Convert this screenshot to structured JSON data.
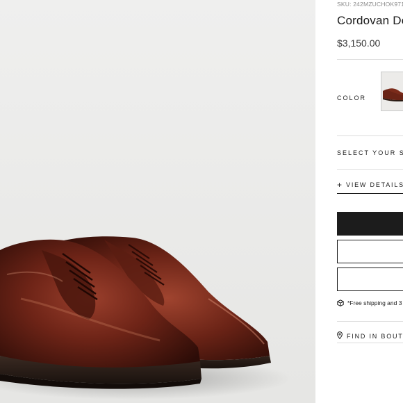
{
  "product": {
    "sku": "SKU: 242MZUCHOK971",
    "title": "Cordovan De",
    "price": "$3,150.00"
  },
  "color_section": {
    "label": "COLOR",
    "swatch": "brown leather derby thumbnail"
  },
  "size_section": {
    "label": "SELECT YOUR SIZ"
  },
  "details": {
    "icon": "plus-icon",
    "label": "VIEW DETAILS"
  },
  "actions": {
    "primary_color": "#1c1c1c",
    "outline_color": "#1c1c1c"
  },
  "shipping": {
    "icon": "box-icon",
    "text": "*Free shipping and 3"
  },
  "boutique": {
    "icon": "location-pin-icon",
    "label": "FIND IN BOUTIQ"
  },
  "image": {
    "description_icon": "product-photo",
    "background_color": "#ebebea",
    "shoe_color": "#5a1e14"
  }
}
